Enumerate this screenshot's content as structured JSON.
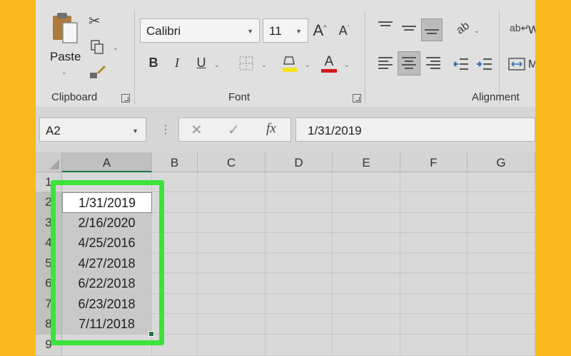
{
  "ribbon": {
    "clipboard": {
      "label": "Clipboard",
      "paste_label": "Paste"
    },
    "font": {
      "label": "Font",
      "family": "Calibri",
      "size": "11"
    },
    "alignment": {
      "label": "Alignment"
    },
    "cut_glyph": "✂",
    "partial_w": "W",
    "partial_m": "M"
  },
  "formula_bar": {
    "name_box": "A2",
    "fx_label": "fx",
    "value": "1/31/2019"
  },
  "grid": {
    "columns": [
      "A",
      "B",
      "C",
      "D",
      "E",
      "F",
      "G"
    ],
    "rows": [
      "1",
      "2",
      "3",
      "4",
      "5",
      "6",
      "7",
      "8",
      "9"
    ],
    "cells": [
      "1/31/2019",
      "2/16/2020",
      "4/25/2016",
      "4/27/2018",
      "6/22/2018",
      "6/23/2018",
      "7/11/2018"
    ]
  },
  "colors": {
    "background": "#f9b81c",
    "highlight": "#3be33b",
    "excel_green": "#217346"
  }
}
